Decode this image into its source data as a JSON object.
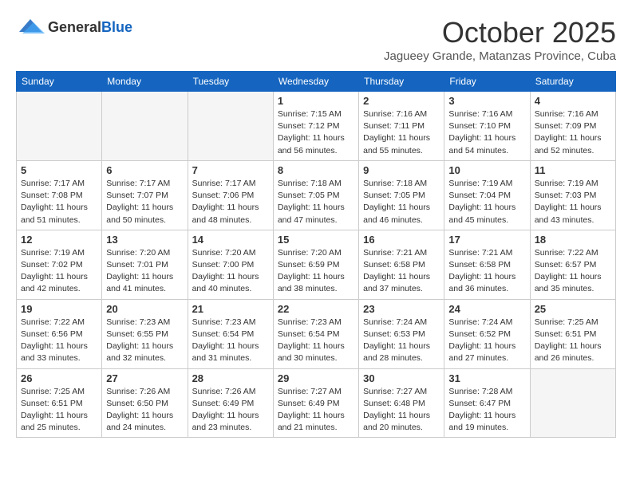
{
  "logo": {
    "general": "General",
    "blue": "Blue"
  },
  "title": "October 2025",
  "subtitle": "Jagueey Grande, Matanzas Province, Cuba",
  "days": [
    "Sunday",
    "Monday",
    "Tuesday",
    "Wednesday",
    "Thursday",
    "Friday",
    "Saturday"
  ],
  "weeks": [
    [
      {
        "num": "",
        "info": ""
      },
      {
        "num": "",
        "info": ""
      },
      {
        "num": "",
        "info": ""
      },
      {
        "num": "1",
        "info": "Sunrise: 7:15 AM\nSunset: 7:12 PM\nDaylight: 11 hours\nand 56 minutes."
      },
      {
        "num": "2",
        "info": "Sunrise: 7:16 AM\nSunset: 7:11 PM\nDaylight: 11 hours\nand 55 minutes."
      },
      {
        "num": "3",
        "info": "Sunrise: 7:16 AM\nSunset: 7:10 PM\nDaylight: 11 hours\nand 54 minutes."
      },
      {
        "num": "4",
        "info": "Sunrise: 7:16 AM\nSunset: 7:09 PM\nDaylight: 11 hours\nand 52 minutes."
      }
    ],
    [
      {
        "num": "5",
        "info": "Sunrise: 7:17 AM\nSunset: 7:08 PM\nDaylight: 11 hours\nand 51 minutes."
      },
      {
        "num": "6",
        "info": "Sunrise: 7:17 AM\nSunset: 7:07 PM\nDaylight: 11 hours\nand 50 minutes."
      },
      {
        "num": "7",
        "info": "Sunrise: 7:17 AM\nSunset: 7:06 PM\nDaylight: 11 hours\nand 48 minutes."
      },
      {
        "num": "8",
        "info": "Sunrise: 7:18 AM\nSunset: 7:05 PM\nDaylight: 11 hours\nand 47 minutes."
      },
      {
        "num": "9",
        "info": "Sunrise: 7:18 AM\nSunset: 7:05 PM\nDaylight: 11 hours\nand 46 minutes."
      },
      {
        "num": "10",
        "info": "Sunrise: 7:19 AM\nSunset: 7:04 PM\nDaylight: 11 hours\nand 45 minutes."
      },
      {
        "num": "11",
        "info": "Sunrise: 7:19 AM\nSunset: 7:03 PM\nDaylight: 11 hours\nand 43 minutes."
      }
    ],
    [
      {
        "num": "12",
        "info": "Sunrise: 7:19 AM\nSunset: 7:02 PM\nDaylight: 11 hours\nand 42 minutes."
      },
      {
        "num": "13",
        "info": "Sunrise: 7:20 AM\nSunset: 7:01 PM\nDaylight: 11 hours\nand 41 minutes."
      },
      {
        "num": "14",
        "info": "Sunrise: 7:20 AM\nSunset: 7:00 PM\nDaylight: 11 hours\nand 40 minutes."
      },
      {
        "num": "15",
        "info": "Sunrise: 7:20 AM\nSunset: 6:59 PM\nDaylight: 11 hours\nand 38 minutes."
      },
      {
        "num": "16",
        "info": "Sunrise: 7:21 AM\nSunset: 6:58 PM\nDaylight: 11 hours\nand 37 minutes."
      },
      {
        "num": "17",
        "info": "Sunrise: 7:21 AM\nSunset: 6:58 PM\nDaylight: 11 hours\nand 36 minutes."
      },
      {
        "num": "18",
        "info": "Sunrise: 7:22 AM\nSunset: 6:57 PM\nDaylight: 11 hours\nand 35 minutes."
      }
    ],
    [
      {
        "num": "19",
        "info": "Sunrise: 7:22 AM\nSunset: 6:56 PM\nDaylight: 11 hours\nand 33 minutes."
      },
      {
        "num": "20",
        "info": "Sunrise: 7:23 AM\nSunset: 6:55 PM\nDaylight: 11 hours\nand 32 minutes."
      },
      {
        "num": "21",
        "info": "Sunrise: 7:23 AM\nSunset: 6:54 PM\nDaylight: 11 hours\nand 31 minutes."
      },
      {
        "num": "22",
        "info": "Sunrise: 7:23 AM\nSunset: 6:54 PM\nDaylight: 11 hours\nand 30 minutes."
      },
      {
        "num": "23",
        "info": "Sunrise: 7:24 AM\nSunset: 6:53 PM\nDaylight: 11 hours\nand 28 minutes."
      },
      {
        "num": "24",
        "info": "Sunrise: 7:24 AM\nSunset: 6:52 PM\nDaylight: 11 hours\nand 27 minutes."
      },
      {
        "num": "25",
        "info": "Sunrise: 7:25 AM\nSunset: 6:51 PM\nDaylight: 11 hours\nand 26 minutes."
      }
    ],
    [
      {
        "num": "26",
        "info": "Sunrise: 7:25 AM\nSunset: 6:51 PM\nDaylight: 11 hours\nand 25 minutes."
      },
      {
        "num": "27",
        "info": "Sunrise: 7:26 AM\nSunset: 6:50 PM\nDaylight: 11 hours\nand 24 minutes."
      },
      {
        "num": "28",
        "info": "Sunrise: 7:26 AM\nSunset: 6:49 PM\nDaylight: 11 hours\nand 23 minutes."
      },
      {
        "num": "29",
        "info": "Sunrise: 7:27 AM\nSunset: 6:49 PM\nDaylight: 11 hours\nand 21 minutes."
      },
      {
        "num": "30",
        "info": "Sunrise: 7:27 AM\nSunset: 6:48 PM\nDaylight: 11 hours\nand 20 minutes."
      },
      {
        "num": "31",
        "info": "Sunrise: 7:28 AM\nSunset: 6:47 PM\nDaylight: 11 hours\nand 19 minutes."
      },
      {
        "num": "",
        "info": ""
      }
    ]
  ]
}
